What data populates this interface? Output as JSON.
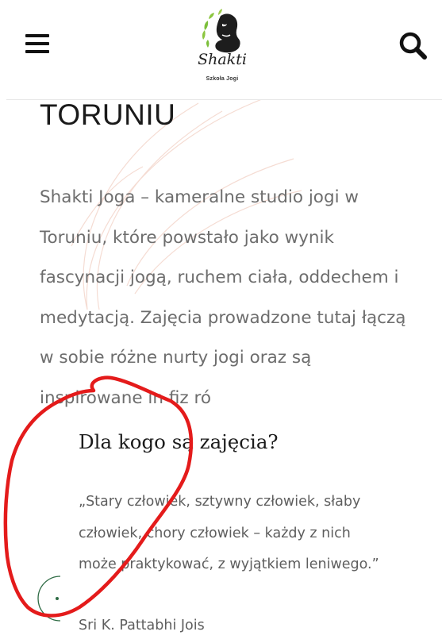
{
  "header": {
    "logo_name": "Shakti",
    "logo_subtitle": "Szkoła Jogi"
  },
  "main": {
    "heading": "TORUNIU",
    "intro": "Shakti Joga – kameralne studio jogi w Toruniu, które powstało jako wynik fascynacji jogą, ruchem ciała, oddechem i medytacją. Zajęcia prowadzone tutaj łączą w sobie różne nurty jogi oraz są inspirowane in fiz ró"
  },
  "card": {
    "title": "Dla kogo są zajęcia?",
    "quote": "„Stary człowiek, sztywny człowiek, słaby człowiek, chory człowiek – każdy z nich może praktykować, z wyjątkiem leniwego.”",
    "author": "Sri K. Pattabhi Jois"
  },
  "colors": {
    "accent_green": "#7cbf3a",
    "annotation_red": "#e41b1b",
    "text_gray": "#6d6d6d"
  },
  "icons": {
    "menu": "hamburger-icon",
    "search": "magnifier-icon"
  }
}
